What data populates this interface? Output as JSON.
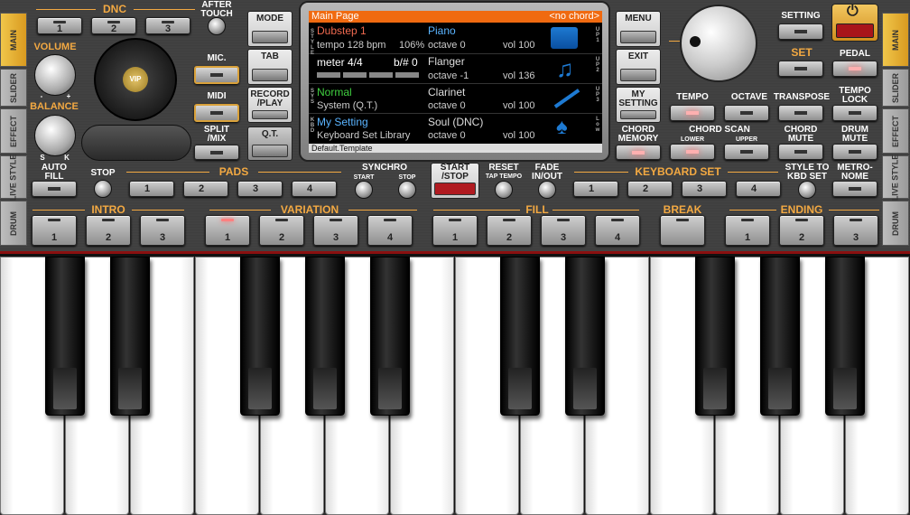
{
  "left_tabs": [
    "MAIN",
    "SLIDER",
    "EFFECT",
    "LIVE STYLE",
    "DRUM"
  ],
  "right_tabs": [
    "MAIN",
    "SLIDER",
    "EFFECT",
    "LIVE STYLE",
    "DRUM"
  ],
  "dnc": {
    "title": "DNC",
    "buttons": [
      "1",
      "2",
      "3"
    ],
    "after_touch": "AFTER TOUCH"
  },
  "volume": {
    "label": "VOLUME",
    "minus": "-",
    "plus": "+"
  },
  "balance": {
    "label": "BALANCE",
    "s": "S",
    "k": "K"
  },
  "disc_logo": "VIP",
  "side_buttons": {
    "mic": "MIC.",
    "midi": "MIDI",
    "split": "SPLIT /MIX"
  },
  "mode_buttons": {
    "mode": "MODE",
    "tab": "TAB",
    "record": "RECORD /PLAY",
    "qt": "Q.T."
  },
  "screen": {
    "header_left": "Main Page",
    "header_right": "<no chord>",
    "style_name": "Dubstep 1",
    "tempo": "tempo 128 bpm",
    "percent": "106%",
    "meter": "meter 4/4",
    "bsharp": "b/# 0",
    "upper1_name": "Piano",
    "upper1_octave": "octave 0",
    "upper1_vol": "vol 100",
    "upper2_name": "Flanger",
    "upper2_octave": "octave -1",
    "upper2_vol": "vol 136",
    "sys_name": "Normal",
    "sys_sub": "System (Q.T.)",
    "upper3_name": "Clarinet",
    "upper3_octave": "octave 0",
    "upper3_vol": "vol 100",
    "kbd_name": "My Setting",
    "kbd_sub": "Keyboard Set Library",
    "low_name": "Soul (DNC)",
    "low_octave": "octave 0",
    "low_vol": "vol 100",
    "footer": "Default.Template",
    "vert_style": "STYLE",
    "vert_sys": "SYS",
    "vert_kbd": "KBD",
    "vert_up1": "UP1",
    "vert_up2": "UP2",
    "vert_up3": "UP3",
    "vert_low": "Low"
  },
  "right_menu": {
    "menu": "MENU",
    "exit": "EXIT",
    "my_setting": "MY SETTING",
    "chord_memory": "CHORD MEMORY"
  },
  "setting": "SETTING",
  "set": "SET",
  "pedal": "PEDAL",
  "right_controls": {
    "tempo": "TEMPO",
    "octave": "OCTAVE",
    "transpose": "TRANSPOSE",
    "tempo_lock": "TEMPO LOCK",
    "chord_scan": "CHORD SCAN",
    "lower": "LOWER",
    "upper": "UPPER",
    "chord_mute": "CHORD MUTE",
    "drum_mute": "DRUM MUTE"
  },
  "row3": {
    "auto_fill": "AUTO FILL",
    "stop": "STOP",
    "pads": "PADS",
    "pad_nums": [
      "1",
      "2",
      "3",
      "4"
    ],
    "synchro": "SYNCHRO",
    "sync_start": "START",
    "sync_stop": "STOP",
    "start_stop": "START /STOP",
    "reset": "RESET",
    "tap_tempo": "TAP TEMPO",
    "fade": "FADE IN/OUT",
    "keyboard_set": "KEYBOARD SET",
    "kbd_nums": [
      "1",
      "2",
      "3",
      "4"
    ],
    "style_to_kbd": "STYLE TO KBD SET",
    "metronome": "METRO- NOME"
  },
  "row4": {
    "intro": "INTRO",
    "intro_nums": [
      "1",
      "2",
      "3"
    ],
    "variation": "VARIATION",
    "var_nums": [
      "1",
      "2",
      "3",
      "4"
    ],
    "fill": "FILL",
    "fill_nums": [
      "1",
      "2",
      "3",
      "4"
    ],
    "break": "BREAK",
    "ending": "ENDING",
    "end_nums": [
      "1",
      "2",
      "3"
    ]
  }
}
